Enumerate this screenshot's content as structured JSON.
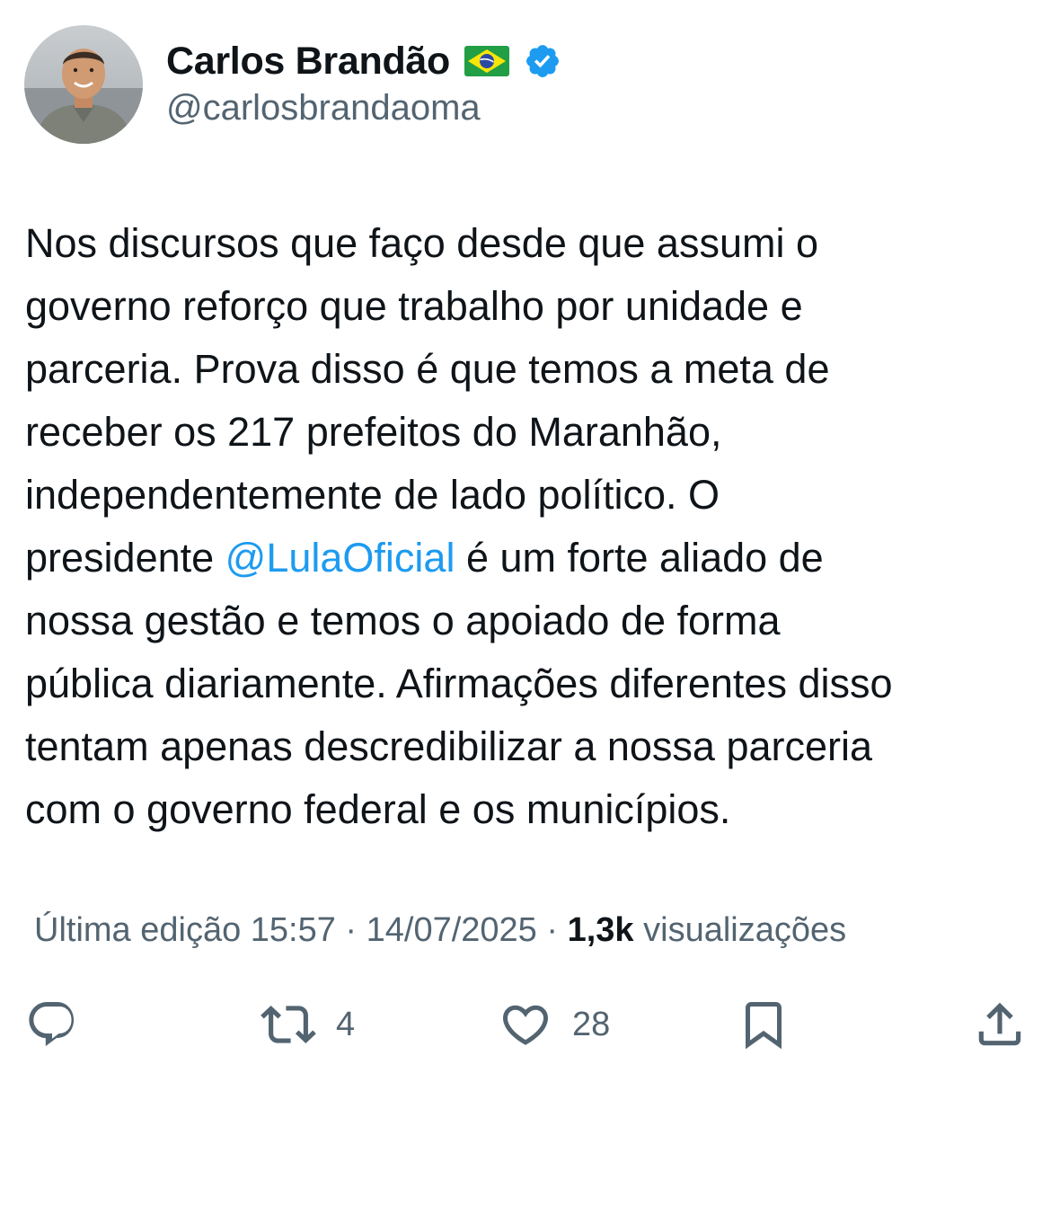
{
  "author": {
    "display_name": "Carlos Brandão",
    "handle": "@carlosbrandaoma",
    "flag_icon": "brazil-flag-icon",
    "verified_icon": "verified-badge-icon",
    "verified_color": "#1d9bf0"
  },
  "tweet": {
    "lines": [
      "Nos discursos que faço desde que assumi o",
      "governo reforço que trabalho por unidade e",
      "parceria. Prova disso é que temos a meta de",
      "receber os 217 prefeitos do Maranhão,",
      "independentemente de lado político. O"
    ],
    "line6_before": "presidente ",
    "line6_mention": "@LulaOficial",
    "line6_after": " é um forte aliado de",
    "lines_rest": [
      "nossa gestão e temos o apoiado de forma",
      "pública diariamente. Afirmações diferentes disso",
      "tentam apenas descredibilizar a nossa parceria",
      "com o governo federal e os municípios."
    ],
    "mention_color": "#1d9bf0"
  },
  "meta": {
    "edited_label": "Última edição 15:57 · 14/07/2025",
    "separator": " · ",
    "views_count": "1,3k",
    "views_label": " visualizações"
  },
  "actions": {
    "reply_icon": "reply-icon",
    "retweet_icon": "retweet-icon",
    "retweet_count": "4",
    "like_icon": "heart-icon",
    "like_count": "28",
    "bookmark_icon": "bookmark-icon",
    "share_icon": "share-icon"
  }
}
